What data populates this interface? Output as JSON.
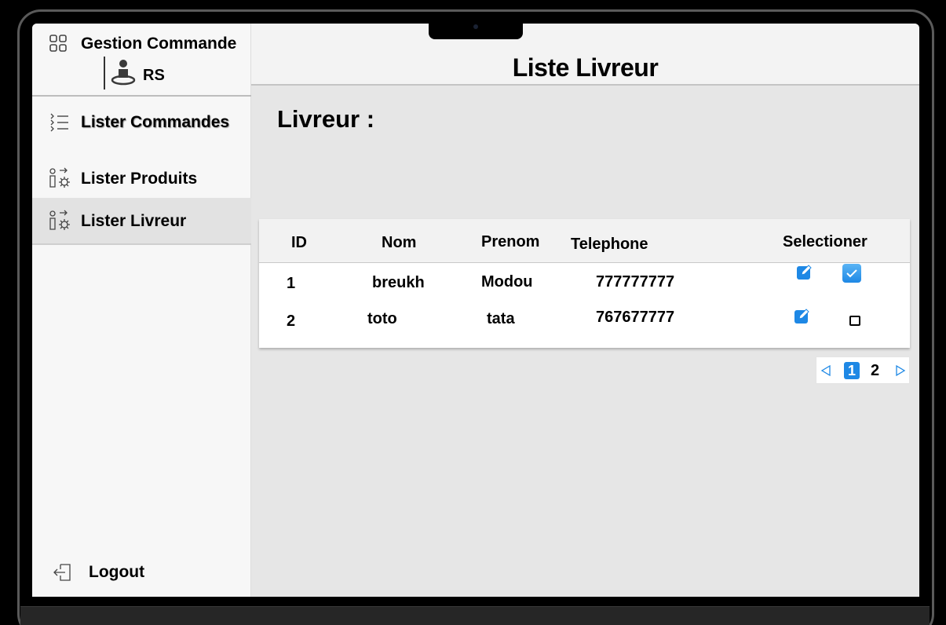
{
  "app": {
    "title": "Gestion Commande",
    "user": "RS"
  },
  "sidebar": {
    "items": [
      {
        "label": "Lister Commandes",
        "icon": "list-icon"
      },
      {
        "label": "Lister Produits",
        "icon": "users-settings-icon"
      },
      {
        "label": "Lister Livreur",
        "icon": "users-settings-icon",
        "active": true
      }
    ],
    "logout": {
      "label": "Logout",
      "icon": "logout-icon"
    }
  },
  "header": {
    "title": "Liste Livreur"
  },
  "main": {
    "section_label": "Livreur :",
    "table": {
      "columns": [
        "ID",
        "Nom",
        "Prenom",
        "Telephone",
        "Selectioner"
      ],
      "rows": [
        {
          "id": "1",
          "nom": "breukh",
          "prenom": "Modou",
          "telephone": "777777777",
          "selected": true
        },
        {
          "id": "2",
          "nom": "toto",
          "prenom": "tata",
          "telephone": "767677777",
          "selected": false
        }
      ]
    },
    "pagination": {
      "pages": [
        "1",
        "2"
      ],
      "current": "1"
    }
  },
  "colors": {
    "accent": "#1e88e5",
    "sidebar_bg": "#f7f7f7",
    "content_bg": "#e6e6e6"
  }
}
